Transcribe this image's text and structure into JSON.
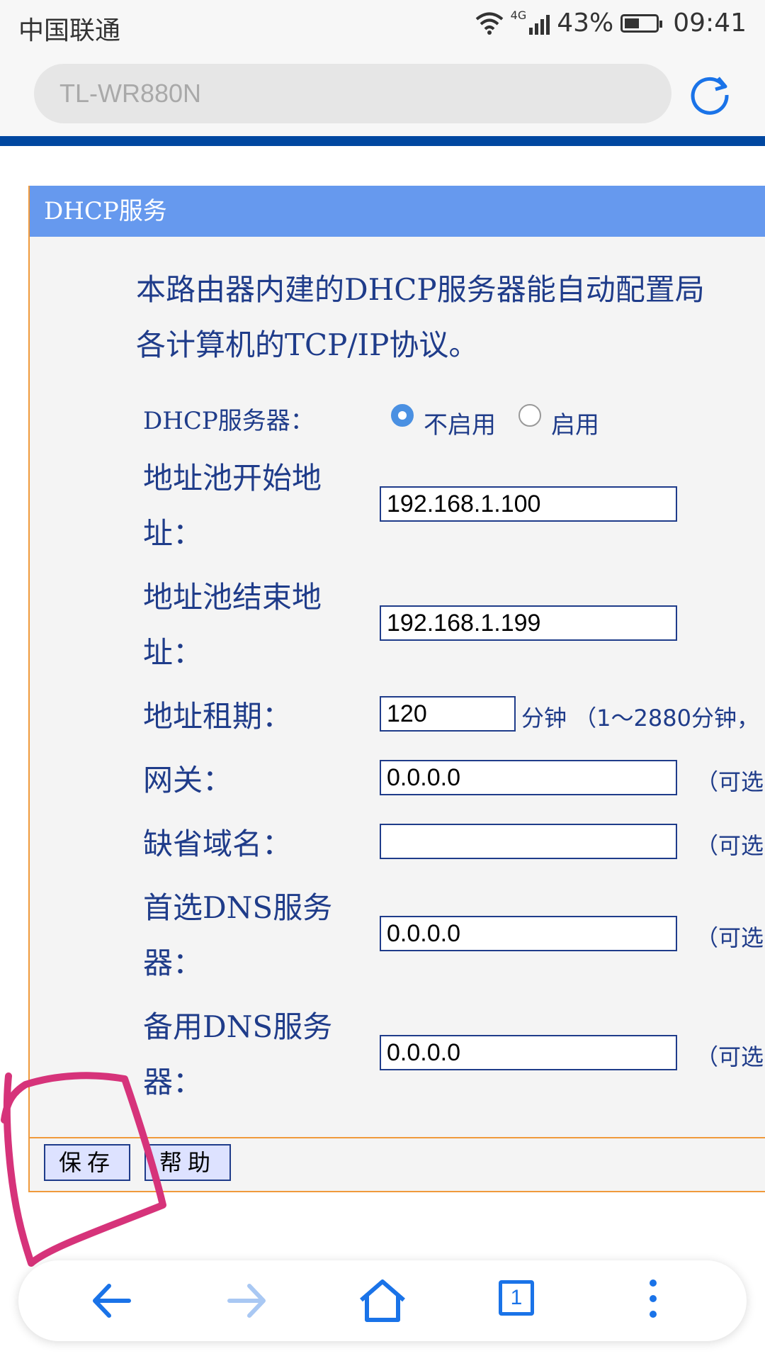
{
  "status_bar": {
    "carrier": "中国联通",
    "network": "4G",
    "battery": "43%",
    "time": "09:41"
  },
  "browser": {
    "url_text": "TL-WR880N",
    "tab_count": "1"
  },
  "panel": {
    "title": "DHCP服务",
    "intro_line1": "本路由器内建的DHCP服务器能自动配置局",
    "intro_line2": "各计算机的TCP/IP协议。"
  },
  "form": {
    "dhcp_label": "DHCP服务器：",
    "radio_disable": "不启用",
    "radio_enable": "启用",
    "dhcp_state": "不启用",
    "pool_start_label_1": "地址池开始地",
    "pool_start_label_2": "址：",
    "pool_start_value": "192.168.1.100",
    "pool_end_label_1": "地址池结束地",
    "pool_end_label_2": "址：",
    "pool_end_value": "192.168.1.199",
    "lease_label": "地址租期：",
    "lease_value": "120",
    "lease_hint": "分钟 （1～2880分钟，",
    "gateway_label": "网关：",
    "gateway_value": "0.0.0.0",
    "domain_label": "缺省域名：",
    "domain_value": "",
    "dns1_label_1": "首选DNS服务",
    "dns1_label_2": "器：",
    "dns1_value": "0.0.0.0",
    "dns2_label_1": "备用DNS服务",
    "dns2_label_2": "器：",
    "dns2_value": "0.0.0.0",
    "optional_hint": "（可选"
  },
  "buttons": {
    "save": "保存",
    "help": "帮助"
  },
  "colors": {
    "panel_header": "#6699ee",
    "panel_border": "#f09a3c",
    "text_blue": "#1f3c8a",
    "annotation": "#d6337a",
    "nav_blue": "#1a73e8"
  },
  "icons": [
    "back-arrow-icon",
    "forward-arrow-icon",
    "home-icon",
    "tabs-icon",
    "more-menu-icon",
    "reload-icon",
    "wifi-icon",
    "signal-icon",
    "battery-icon"
  ]
}
